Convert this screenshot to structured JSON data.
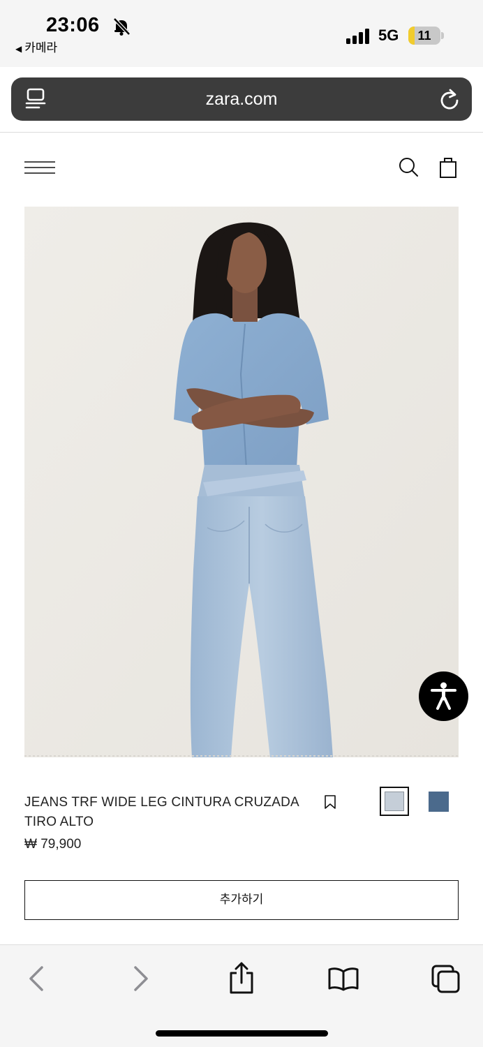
{
  "status_bar": {
    "time": "23:06",
    "back_app": "카메라",
    "network": "5G",
    "battery_level": "11"
  },
  "browser": {
    "url": "zara.com"
  },
  "header": {
    "menu_icon": "hamburger-icon",
    "search_icon": "search-icon",
    "bag_icon": "shopping-bag-icon"
  },
  "product": {
    "image_alt": "model-wearing-light-blue-denim",
    "name_line1": "JEANS TRF WIDE LEG CINTURA CRUZADA",
    "name_line2": "TIRO ALTO",
    "price": "₩ 79,900",
    "colors": [
      {
        "hex": "#c5ced8",
        "selected": true
      },
      {
        "hex": "#4b6a8c",
        "selected": false
      }
    ],
    "add_button_label": "추가하기"
  },
  "toolbar": {
    "icons": [
      "back-icon",
      "forward-icon",
      "share-icon",
      "bookmarks-icon",
      "tabs-icon"
    ]
  },
  "colors": {
    "url_bar_bg": "#3c3c3c",
    "battery_accent": "#f1cc2e",
    "accessibility_button": "#000000"
  }
}
